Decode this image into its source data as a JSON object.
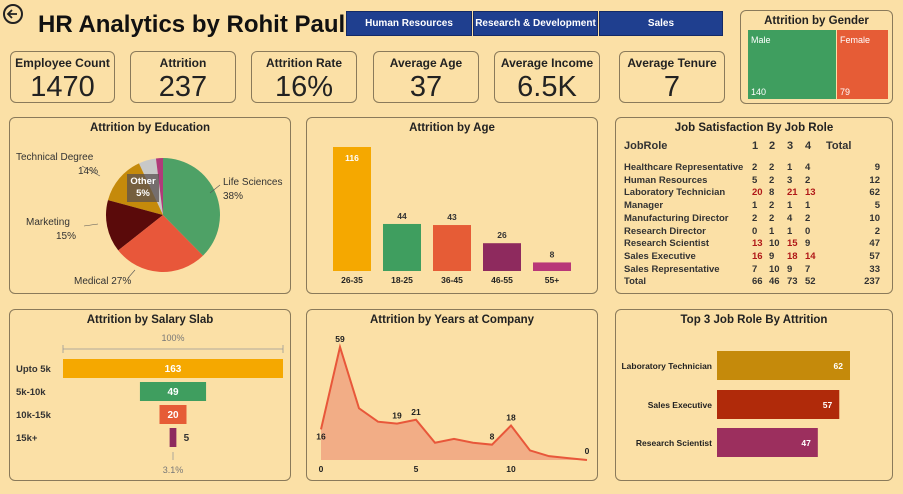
{
  "header": {
    "title": "HR Analytics by Rohit Paul",
    "back_icon": "back-arrow-icon"
  },
  "tabs": [
    "Human Resources",
    "Research & Development",
    "Sales"
  ],
  "kpis": [
    {
      "label": "Employee Count",
      "value": "1470"
    },
    {
      "label": "Attrition",
      "value": "237"
    },
    {
      "label": "Attrition Rate",
      "value": "16%"
    },
    {
      "label": "Average Age",
      "value": "37"
    },
    {
      "label": "Average Income",
      "value": "6.5K"
    },
    {
      "label": "Average Tenure",
      "value": "7"
    }
  ],
  "gender": {
    "title": "Attrition by Gender",
    "male_label": "Male",
    "male_value": "140",
    "male_color": "#3f9e5f",
    "female_label": "Female",
    "female_value": "79",
    "female_color": "#e65c36"
  },
  "panels": {
    "education": "Attrition by Education",
    "age": "Attrition by Age",
    "job_satisfaction": "Job Satisfaction By Job Role",
    "salary": "Attrition by Salary Slab",
    "years": "Attrition by Years at Company",
    "top3": "Top 3 Job Role By Attrition"
  },
  "education_labels": {
    "technical": "Technical Degree",
    "technical_pct": "14%",
    "other": "Other",
    "other_pct": "5%",
    "life": "Life Sciences",
    "life_pct": "38%",
    "marketing": "Marketing",
    "marketing_pct": "15%",
    "medical": "Medical 27%"
  },
  "job_table": {
    "headers": [
      "JobRole",
      "1",
      "2",
      "3",
      "4",
      "Total"
    ],
    "rows": [
      [
        "Healthcare Representative",
        "2",
        "2",
        "1",
        "4",
        "9"
      ],
      [
        "Human Resources",
        "5",
        "2",
        "3",
        "2",
        "12"
      ],
      [
        "Laboratory Technician",
        "20",
        "8",
        "21",
        "13",
        "62"
      ],
      [
        "Manager",
        "1",
        "2",
        "1",
        "1",
        "5"
      ],
      [
        "Manufacturing Director",
        "2",
        "2",
        "4",
        "2",
        "10"
      ],
      [
        "Research Director",
        "0",
        "1",
        "1",
        "0",
        "2"
      ],
      [
        "Research Scientist",
        "13",
        "10",
        "15",
        "9",
        "47"
      ],
      [
        "Sales Executive",
        "16",
        "9",
        "18",
        "14",
        "57"
      ],
      [
        "Sales Representative",
        "7",
        "10",
        "9",
        "7",
        "33"
      ],
      [
        "Total",
        "66",
        "46",
        "73",
        "52",
        "237"
      ]
    ],
    "highlight_color": "#b01818"
  },
  "salary_labels": {
    "top_pct": "100%",
    "bottom_pct": "3.1%"
  },
  "chart_data": [
    {
      "type": "pie",
      "title": "Attrition by Education",
      "categories": [
        "Life Sciences",
        "Medical",
        "Marketing",
        "Technical Degree",
        "Other",
        "Other (pink)"
      ],
      "values": [
        38,
        27,
        15,
        14,
        5,
        2
      ],
      "colors": [
        "#4ea166",
        "#e8573a",
        "#5a0a0a",
        "#c58a0b",
        "#c8c8c8",
        "#b03a7a"
      ]
    },
    {
      "type": "bar",
      "title": "Attrition by Age",
      "categories": [
        "26-35",
        "18-25",
        "36-45",
        "46-55",
        "55+"
      ],
      "values": [
        116,
        44,
        43,
        26,
        8
      ],
      "colors": [
        "#f5a800",
        "#3f9e5f",
        "#e65c36",
        "#8e2a5e",
        "#b83778"
      ]
    },
    {
      "type": "bar",
      "title": "Attrition by Salary Slab",
      "categories": [
        "Upto 5k",
        "5k-10k",
        "10k-15k",
        "15k+"
      ],
      "values": [
        163,
        49,
        20,
        5
      ],
      "colors": [
        "#f5a800",
        "#3f9e5f",
        "#e65c36",
        "#8e2a5e"
      ]
    },
    {
      "type": "area",
      "title": "Attrition by Years at Company",
      "x": [
        0,
        1,
        2,
        3,
        4,
        5,
        6,
        7,
        8,
        9,
        10,
        11,
        12,
        13,
        14
      ],
      "values": [
        16,
        59,
        27,
        20,
        19,
        21,
        9,
        11,
        9,
        8,
        18,
        5,
        2,
        1,
        0
      ],
      "labels": [
        {
          "x": 0,
          "y": 16
        },
        {
          "x": 1,
          "y": 59
        },
        {
          "x": 4,
          "y": 19
        },
        {
          "x": 5,
          "y": 21
        },
        {
          "x": 9,
          "y": 8
        },
        {
          "x": 10,
          "y": 18
        },
        {
          "x": 14,
          "y": 0
        }
      ],
      "xticks": [
        0,
        5,
        10
      ],
      "color": "#f2ad86",
      "line_color": "#e8573a"
    },
    {
      "type": "bar",
      "title": "Top 3 Job Role By Attrition",
      "categories": [
        "Laboratory Technician",
        "Sales Executive",
        "Research Scientist"
      ],
      "values": [
        62,
        57,
        47
      ],
      "colors": [
        "#c58a0b",
        "#b02a0a",
        "#9c2f5e"
      ]
    }
  ]
}
